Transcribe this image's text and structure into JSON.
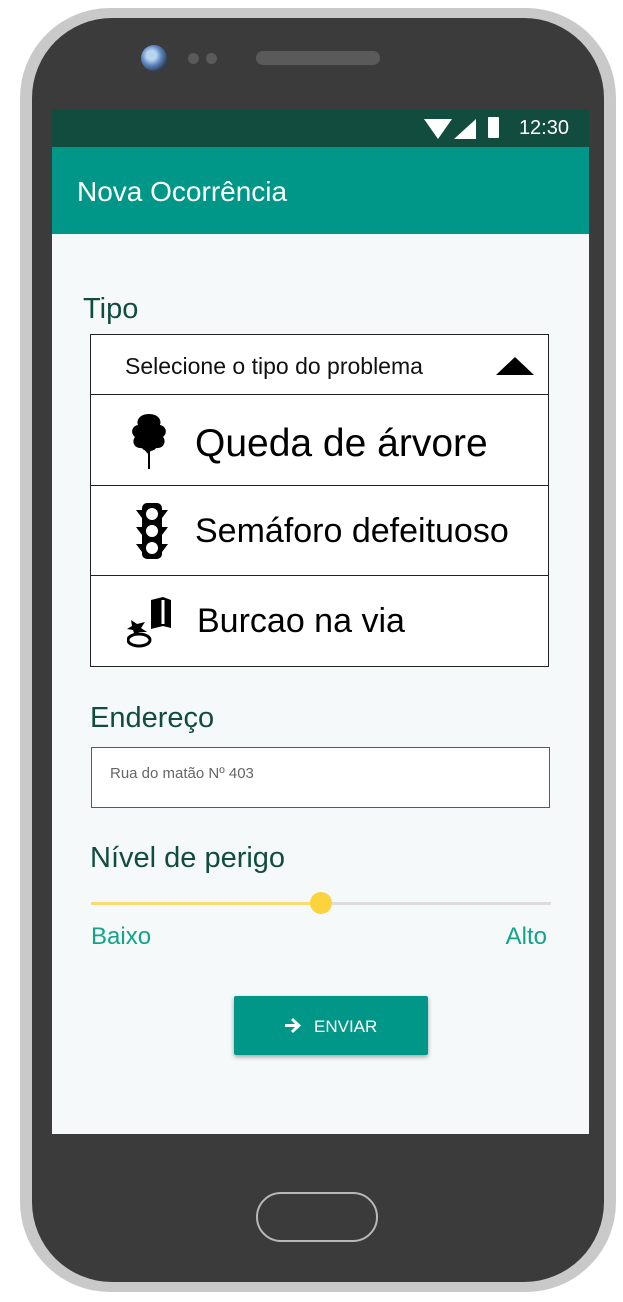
{
  "status_bar": {
    "time": "12:30"
  },
  "app_bar": {
    "title": "Nova Ocorrência"
  },
  "form": {
    "type_label": "Tipo",
    "type_select": {
      "selected_text": "Selecione o tipo do problema",
      "options": [
        {
          "label": "Queda de árvore",
          "icon": "tree-icon"
        },
        {
          "label": "Semáforo defeituoso",
          "icon": "traffic-light-icon"
        },
        {
          "label": "Burcao na via",
          "icon": "pothole-icon"
        }
      ]
    },
    "address_label": "Endereço",
    "address_value": "Rua do matão Nº 403",
    "danger_label": "Nível de perigo",
    "danger_slider": {
      "level": 0.5,
      "min_label": "Baixo",
      "max_label": "Alto"
    },
    "submit_label": "ENVIAR"
  },
  "colors": {
    "app_bar": "#009688",
    "status_bar": "#124c3f",
    "accent_text": "#13a389",
    "slider_thumb": "#fbd33c"
  }
}
